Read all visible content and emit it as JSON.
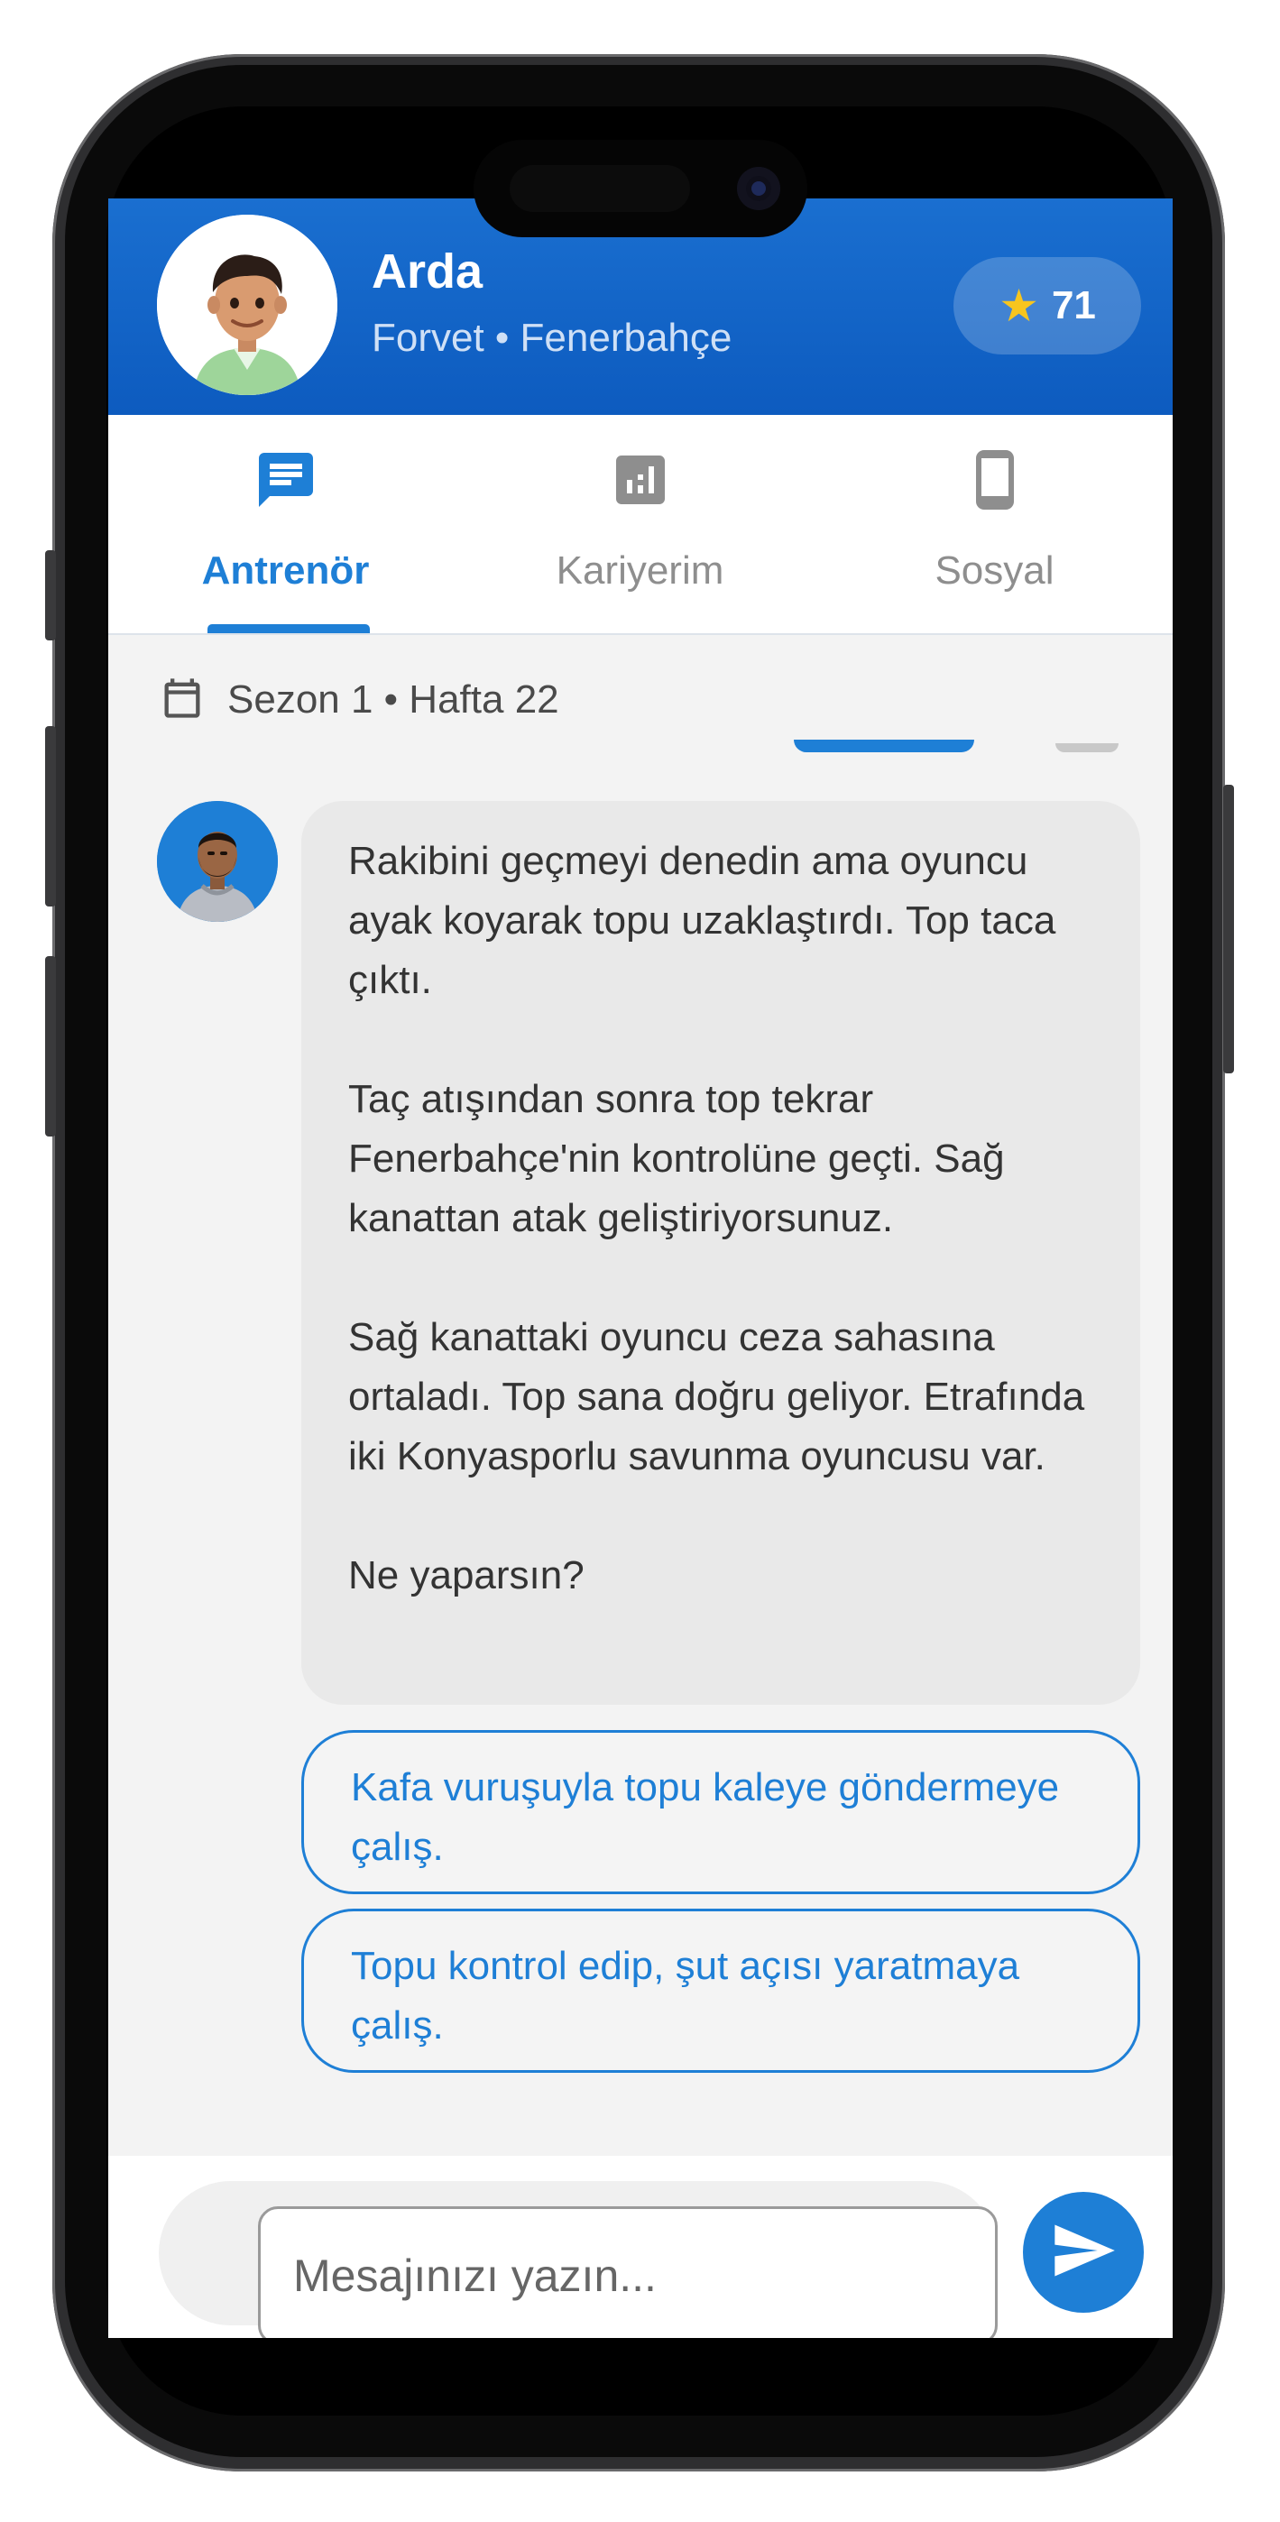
{
  "header": {
    "name": "Arda",
    "subtitle": "Forvet • Fenerbahçe",
    "score_icon": "star-icon",
    "score": "71"
  },
  "tabs": [
    {
      "label": "Antrenör",
      "icon": "chat-icon",
      "active": true
    },
    {
      "label": "Kariyerim",
      "icon": "bar-chart-icon",
      "active": false
    },
    {
      "label": "Sosyal",
      "icon": "phone-icon",
      "active": false
    }
  ],
  "week": {
    "icon": "calendar-icon",
    "text": "Sezon 1 • Hafta 22"
  },
  "message": {
    "paragraphs": [
      "Rakibini geçmeyi denedin ama oyuncu ayak koyarak topu uzaklaştırdı. Top taca çıktı.",
      "Taç atışından sonra top tekrar Fenerbahçe'nin kontrolüne geçti. Sağ kanattan atak geliştiriyorsunuz.",
      "Sağ kanattaki oyuncu ceza sahasına ortaladı. Top sana doğru geliyor. Etrafında iki Konyasporlu savunma oyuncusu var.",
      "Ne yaparsın?"
    ]
  },
  "options": [
    "Kafa vuruşuyla topu kaleye göndermeye çalış.",
    "Topu kontrol edip, şut açısı yaratmaya çalış."
  ],
  "composer": {
    "placeholder": "Mesajınızı yazın...",
    "send_icon": "send-icon"
  },
  "colors": {
    "primary": "#1e7fd6",
    "header_top": "#1a6fd0",
    "star": "#f7c51e",
    "bubble": "#e9e9e9"
  }
}
